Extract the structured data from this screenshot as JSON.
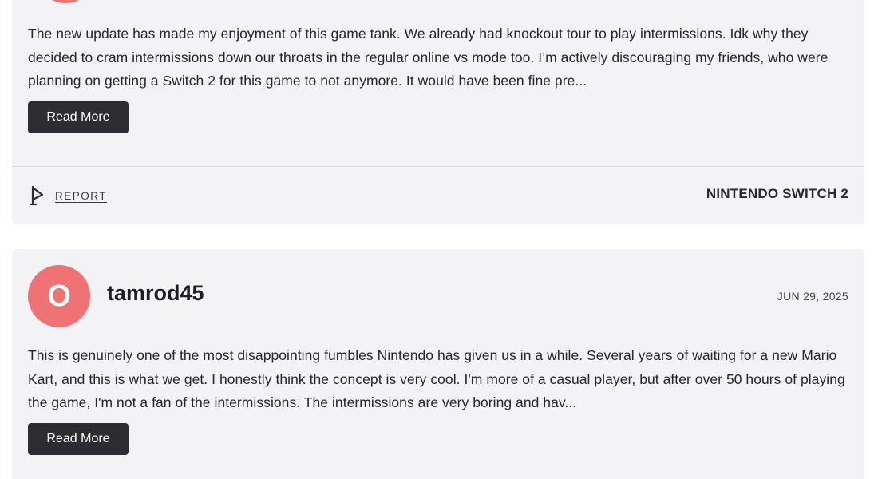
{
  "reviews": [
    {
      "text": "The new update has made my enjoyment of this game tank. We already had knockout tour to play intermissions. Idk why they decided to cram intermissions down our throats in the regular online vs mode too. I’m actively discouraging my friends, who were planning on getting a Switch 2 for this game to not anymore. It would have been fine pre...",
      "read_more_label": "Read More",
      "report_label": "REPORT",
      "report_icon": "flag-icon",
      "platform": "NINTENDO SWITCH 2"
    },
    {
      "avatar_letter": "O",
      "username": "tamrod45",
      "date": "JUN 29, 2025",
      "text": "This is genuinely one of the most disappointing fumbles Nintendo has given us in a while. Several years of waiting for a new Mario Kart, and this is what we get. I honestly think the concept is very cool. I'm more of a casual player, but after over 50 hours of playing the game, I'm not a fan of the intermissions. The intermissions are very boring and hav...",
      "read_more_label": "Read More"
    }
  ],
  "colors": {
    "card_background": "#f3f2f5",
    "avatar": "#ef7374",
    "button": "#2d2d31",
    "text": "#26262a"
  }
}
